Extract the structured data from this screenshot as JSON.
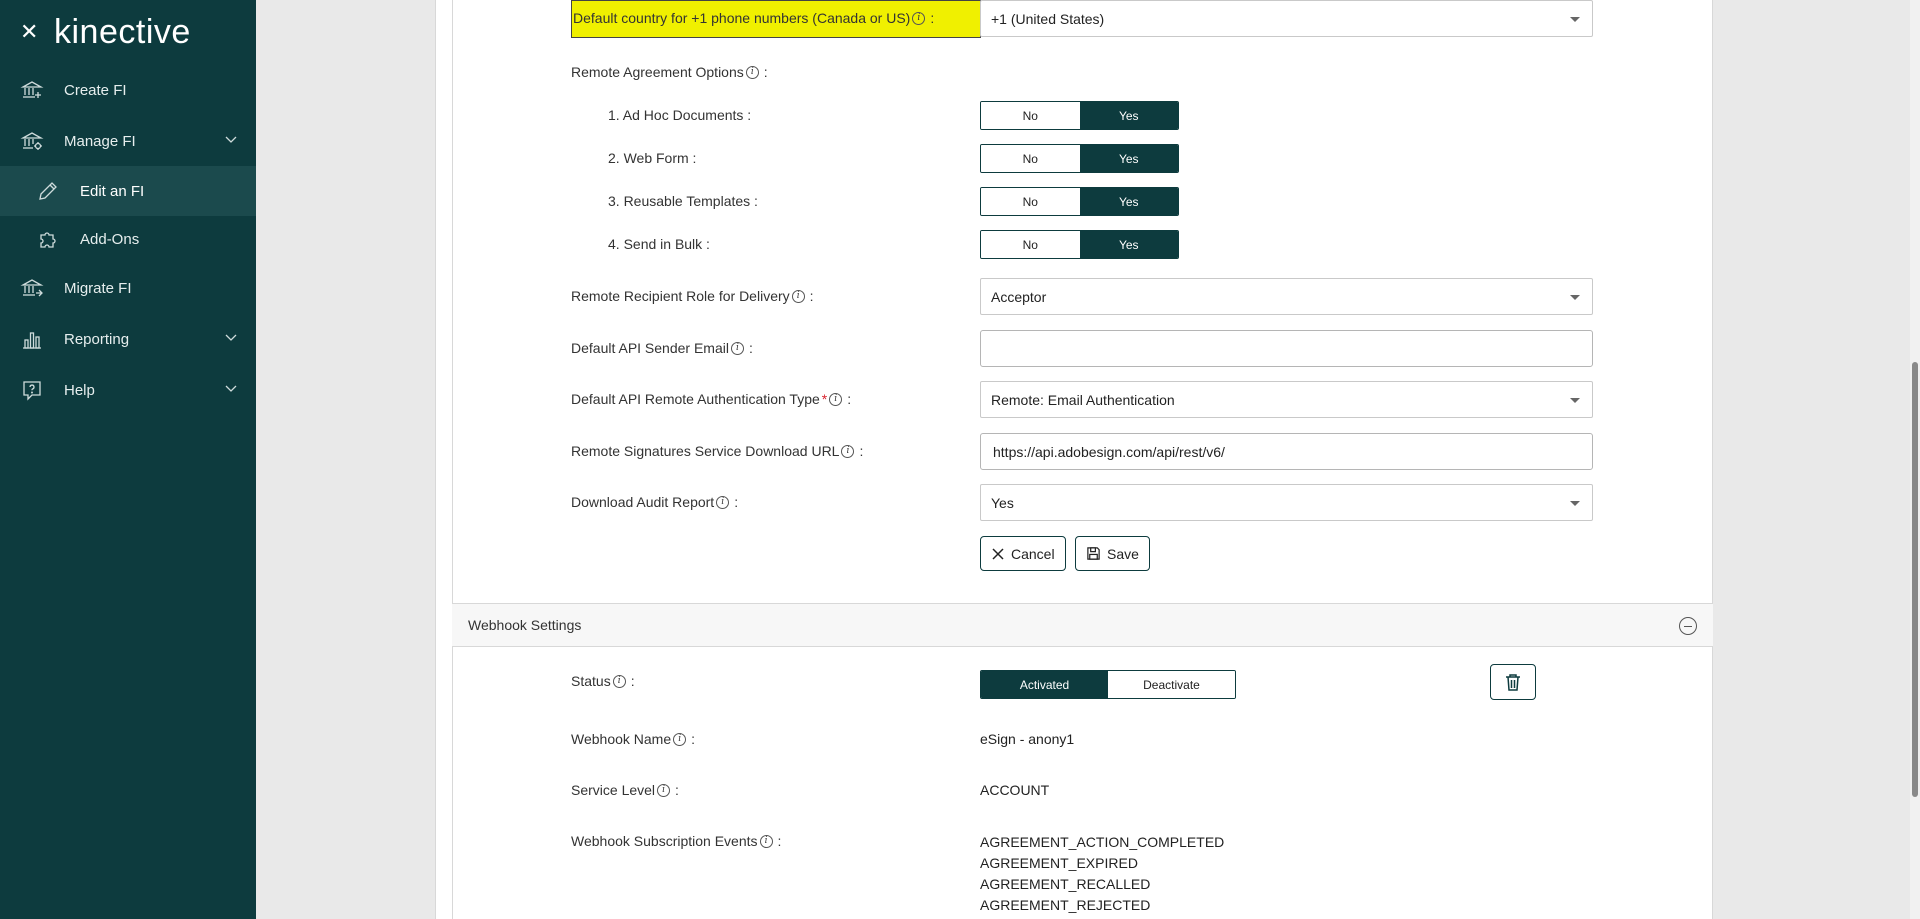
{
  "sidebar": {
    "logo": "kinective",
    "items": [
      {
        "label": "Create FI",
        "icon": "bank-plus-icon"
      },
      {
        "label": "Manage FI",
        "icon": "bank-gear-icon"
      },
      {
        "label": "Edit an FI",
        "icon": "pencil-icon"
      },
      {
        "label": "Add-Ons",
        "icon": "puzzle-icon"
      },
      {
        "label": "Migrate FI",
        "icon": "bank-arrow-icon"
      },
      {
        "label": "Reporting",
        "icon": "bar-chart-icon"
      },
      {
        "label": "Help",
        "icon": "help-icon"
      }
    ]
  },
  "form": {
    "default_country": {
      "label": "Default country for +1 phone numbers (Canada or US)",
      "value": "+1 (United States)"
    },
    "remote_agreement": {
      "label": "Remote Agreement Options"
    },
    "options": [
      {
        "label": "1. Ad Hoc Documents :",
        "no": "No",
        "yes": "Yes"
      },
      {
        "label": "2. Web Form :",
        "no": "No",
        "yes": "Yes"
      },
      {
        "label": "3. Reusable Templates :",
        "no": "No",
        "yes": "Yes"
      },
      {
        "label": "4. Send in Bulk :",
        "no": "No",
        "yes": "Yes"
      }
    ],
    "recipient_role": {
      "label": "Remote Recipient Role for Delivery",
      "value": "Acceptor"
    },
    "api_sender_email": {
      "label": "Default API Sender Email",
      "value": ""
    },
    "api_auth_type": {
      "label": "Default API Remote Authentication Type",
      "required": "*",
      "value": "Remote: Email Authentication"
    },
    "download_url": {
      "label": "Remote Signatures Service Download URL",
      "value": "https://api.adobesign.com/api/rest/v6/"
    },
    "audit_report": {
      "label": "Download Audit Report",
      "value": "Yes"
    },
    "cancel_label": "Cancel",
    "save_label": "Save"
  },
  "webhook": {
    "title": "Webhook Settings",
    "status": {
      "label": "Status",
      "activated": "Activated",
      "deactivate": "Deactivate"
    },
    "name": {
      "label": "Webhook Name",
      "value": "eSign - anony1"
    },
    "service_level": {
      "label": "Service Level",
      "value": "ACCOUNT"
    },
    "events": {
      "label": "Webhook Subscription Events",
      "values": [
        "AGREEMENT_ACTION_COMPLETED",
        "AGREEMENT_EXPIRED",
        "AGREEMENT_RECALLED",
        "AGREEMENT_REJECTED"
      ]
    }
  },
  "colors": {
    "sidebar_bg": "#0d3b3e",
    "highlight": "#f0f000",
    "accent": "#0d3b3e"
  }
}
